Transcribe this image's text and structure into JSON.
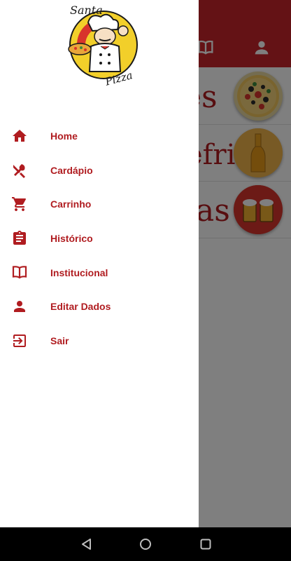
{
  "app": {
    "categories": [
      {
        "text": "es",
        "icon": "pizza-image"
      },
      {
        "text": "efri",
        "icon": "beer-bottle-image"
      },
      {
        "text": "as",
        "icon": "beer-mugs-image"
      }
    ]
  },
  "drawer": {
    "logo": {
      "top_text": "Santa",
      "bottom_text": "Pizza"
    },
    "items": [
      {
        "label": "Home",
        "icon": "home-icon"
      },
      {
        "label": "Cardápio",
        "icon": "utensils-icon"
      },
      {
        "label": "Carrinho",
        "icon": "cart-icon"
      },
      {
        "label": "Histórico",
        "icon": "clipboard-icon"
      },
      {
        "label": "Institucional",
        "icon": "book-icon"
      },
      {
        "label": "Editar Dados",
        "icon": "person-icon"
      },
      {
        "label": "Sair",
        "icon": "logout-icon"
      }
    ]
  },
  "colors": {
    "accent": "#b01c20",
    "appbar": "#c8242a",
    "scrim": "rgba(0,0,0,0.5)"
  }
}
